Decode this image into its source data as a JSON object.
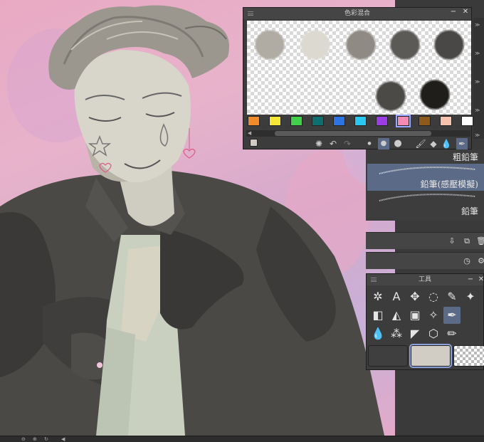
{
  "color_mix_panel": {
    "title": "色彩混合",
    "minimize": "−",
    "close": "✕",
    "mix_colors": [
      "#b0aba3",
      "#dcd9d0",
      "#8f8b84",
      "#5c5a57",
      "#4a4846",
      "#4c4a47",
      "#1f1e1b"
    ],
    "swatches": [
      "#f08a2a",
      "#f4e735",
      "#42d04a",
      "#0f6e6e",
      "#2c74e3",
      "#28c8f2",
      "#9b3de3",
      "#f58ab5",
      "#8d5a1c",
      "#f6c3ae",
      "#ffffff"
    ],
    "selected_swatch": 7,
    "tool_icons": [
      "spinner-icon",
      "undo-icon",
      "redo-icon",
      "dot-small-icon",
      "dot-medium-icon",
      "dot-large-icon",
      "brush-icon",
      "blend-icon",
      "water-drop-icon",
      "pen-tool-icon"
    ]
  },
  "brushes": {
    "items": [
      {
        "label": "粗鉛筆",
        "selected": false
      },
      {
        "label": "鉛筆(感壓模擬)",
        "selected": true
      },
      {
        "label": "鉛筆",
        "selected": false
      }
    ]
  },
  "tool_panel": {
    "title": "工具",
    "minimize": "−",
    "close": "✕",
    "tools": [
      "magic-wand-icon",
      "text-icon",
      "move-icon",
      "lasso-icon",
      "pen-nib-icon",
      "sparkle-icon",
      "eraser-icon",
      "fill-icon",
      "gradient-icon",
      "star-sparkle-icon",
      "brush-active-icon",
      "droplet-icon",
      "spray-icon",
      "ruler-icon",
      "cube-icon",
      "pencil-icon"
    ],
    "active_tool": 10,
    "main_color": "#3f3f3f",
    "sub_color": "#d1cdc4"
  },
  "colors": {
    "panel_bg": "#3c3c3c",
    "selection": "#5b6a86",
    "canvas_pink": "#e7b3cb"
  }
}
